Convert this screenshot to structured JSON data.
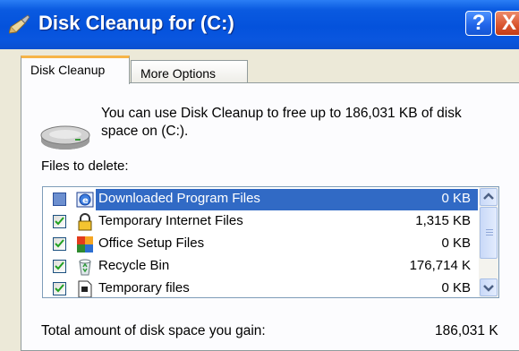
{
  "window": {
    "title": "Disk Cleanup for  (C:)",
    "help_symbol": "?",
    "close_symbol": "X"
  },
  "tabs": [
    {
      "label": "Disk Cleanup",
      "active": true
    },
    {
      "label": "More Options",
      "active": false
    }
  ],
  "intro_text": "You can use Disk Cleanup to free up to 186,031 KB of disk space on  (C:).",
  "files_label": "Files to delete:",
  "files": [
    {
      "name": "Downloaded Program Files",
      "size": "0 KB",
      "checked": false,
      "selected": true,
      "icon": "ie-globe-icon"
    },
    {
      "name": "Temporary Internet Files",
      "size": "1,315 KB",
      "checked": true,
      "selected": false,
      "icon": "lock-icon"
    },
    {
      "name": "Office Setup Files",
      "size": "0 KB",
      "checked": true,
      "selected": false,
      "icon": "office-icon"
    },
    {
      "name": "Recycle Bin",
      "size": "176,714 K",
      "checked": true,
      "selected": false,
      "icon": "recycle-bin-icon"
    },
    {
      "name": "Temporary files",
      "size": "0 KB",
      "checked": true,
      "selected": false,
      "icon": "file-icon"
    }
  ],
  "total": {
    "label": "Total amount of disk space you gain:",
    "value": "186,031 K"
  },
  "colors": {
    "titlebar": "#0452dc",
    "selection": "#316ac5",
    "tab_highlight": "#f6b447",
    "close_button": "#d9542d"
  }
}
